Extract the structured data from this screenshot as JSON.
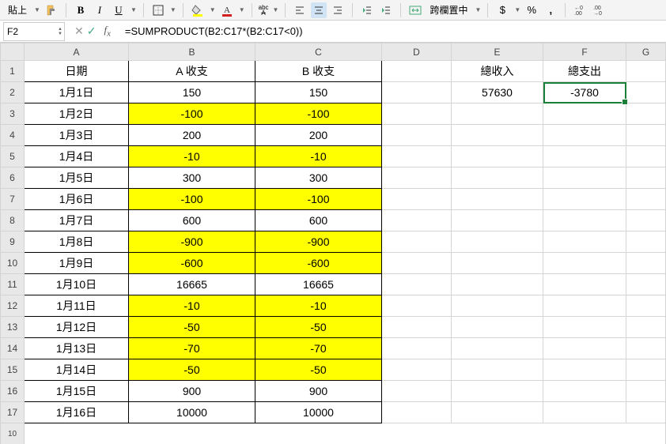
{
  "toolbar": {
    "paste_label": "貼上",
    "bold": "B",
    "italic": "I",
    "underline": "U",
    "abc": "abc",
    "span_center_label": "跨欄置中",
    "currency": "$",
    "percent": "%",
    "comma": ",",
    "dec_inc": ".0",
    "dec_dec": ".00"
  },
  "formula_bar": {
    "cell_ref": "F2",
    "formula": "=SUMPRODUCT(B2:C17*(B2:C17<0))"
  },
  "columns": [
    "A",
    "B",
    "C",
    "D",
    "E",
    "F",
    "G"
  ],
  "headers": {
    "a": "日期",
    "b": "A 收支",
    "c": "B 收支",
    "e1": "總收入",
    "f1": "總支出",
    "e2": "57630",
    "f2": "-3780"
  },
  "rows": [
    {
      "n": 1
    },
    {
      "n": 2,
      "a": "1月1日",
      "b": "150",
      "c": "150",
      "hl": false
    },
    {
      "n": 3,
      "a": "1月2日",
      "b": "-100",
      "c": "-100",
      "hl": true
    },
    {
      "n": 4,
      "a": "1月3日",
      "b": "200",
      "c": "200",
      "hl": false
    },
    {
      "n": 5,
      "a": "1月4日",
      "b": "-10",
      "c": "-10",
      "hl": true
    },
    {
      "n": 6,
      "a": "1月5日",
      "b": "300",
      "c": "300",
      "hl": false
    },
    {
      "n": 7,
      "a": "1月6日",
      "b": "-100",
      "c": "-100",
      "hl": true
    },
    {
      "n": 8,
      "a": "1月7日",
      "b": "600",
      "c": "600",
      "hl": false
    },
    {
      "n": 9,
      "a": "1月8日",
      "b": "-900",
      "c": "-900",
      "hl": true
    },
    {
      "n": 10,
      "a": "1月9日",
      "b": "-600",
      "c": "-600",
      "hl": true
    },
    {
      "n": 11,
      "a": "1月10日",
      "b": "16665",
      "c": "16665",
      "hl": false
    },
    {
      "n": 12,
      "a": "1月11日",
      "b": "-10",
      "c": "-10",
      "hl": true
    },
    {
      "n": 13,
      "a": "1月12日",
      "b": "-50",
      "c": "-50",
      "hl": true
    },
    {
      "n": 14,
      "a": "1月13日",
      "b": "-70",
      "c": "-70",
      "hl": true
    },
    {
      "n": 15,
      "a": "1月14日",
      "b": "-50",
      "c": "-50",
      "hl": true
    },
    {
      "n": 16,
      "a": "1月15日",
      "b": "900",
      "c": "900",
      "hl": false
    },
    {
      "n": 17,
      "a": "1月16日",
      "b": "10000",
      "c": "10000",
      "hl": false
    }
  ]
}
